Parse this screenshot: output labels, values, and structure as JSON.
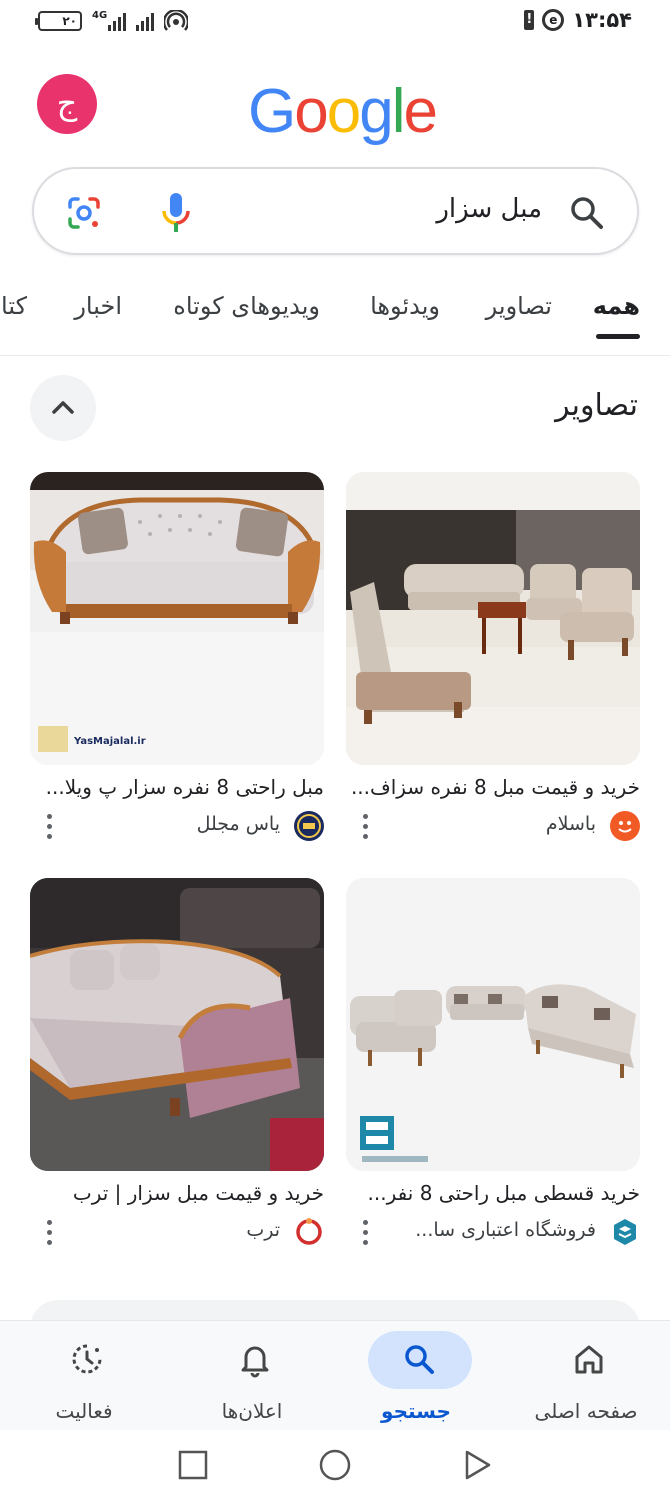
{
  "status_bar": {
    "battery": "۲۰",
    "network_label": "4G",
    "time": "۱۳:۵۴"
  },
  "header": {
    "avatar_letter": "ج",
    "logo": [
      "G",
      "o",
      "o",
      "g",
      "l",
      "e"
    ],
    "logo_colors": [
      "#4285F4",
      "#EA4335",
      "#FBBC05",
      "#4285F4",
      "#34A853",
      "#EA4335"
    ]
  },
  "search": {
    "query": "مبل سزار"
  },
  "tabs": [
    {
      "label": "همه",
      "active": true
    },
    {
      "label": "تصاویر",
      "active": false
    },
    {
      "label": "ویدئوها",
      "active": false
    },
    {
      "label": "ویدیوهای کوتاه",
      "active": false
    },
    {
      "label": "اخبار",
      "active": false
    },
    {
      "label": "کتا",
      "active": false
    }
  ],
  "images_section": {
    "title": "تصاویر",
    "cards": [
      {
        "title": "خرید و قیمت مبل 8 نفره سزاف...",
        "source": "باسلام",
        "source_icon": "basalam-logo-icon",
        "source_color": "#f15a24"
      },
      {
        "title": "مبل راحتی 8 نفره سزار پ ویلا...",
        "source": "یاس مجلل",
        "source_icon": "yas-mojalal-logo-icon",
        "source_color": "#1a2a5e",
        "watermark": "YasMajalal.ir"
      },
      {
        "title": "خرید قسطی مبل راحتی 8 نفر...",
        "source": "فروشگاه اعتباری سا...",
        "source_icon": "store-logo-icon",
        "source_color": "#1e88a8"
      },
      {
        "title": "خرید و قیمت مبل سزار | ترب",
        "source": "ترب",
        "source_icon": "torob-logo-icon",
        "source_color": "#d32f2f"
      }
    ]
  },
  "bottom_nav": [
    {
      "label": "صفحه اصلی",
      "icon": "home-icon",
      "active": false
    },
    {
      "label": "جستجو",
      "icon": "search-icon",
      "active": true
    },
    {
      "label": "اعلان‌ها",
      "icon": "bell-icon",
      "active": false
    },
    {
      "label": "فعالیت",
      "icon": "activity-icon",
      "active": false
    }
  ],
  "colors": {
    "accent": "#0b57d0",
    "nav_pill": "#d3e3fd",
    "avatar": "#e8336c"
  }
}
